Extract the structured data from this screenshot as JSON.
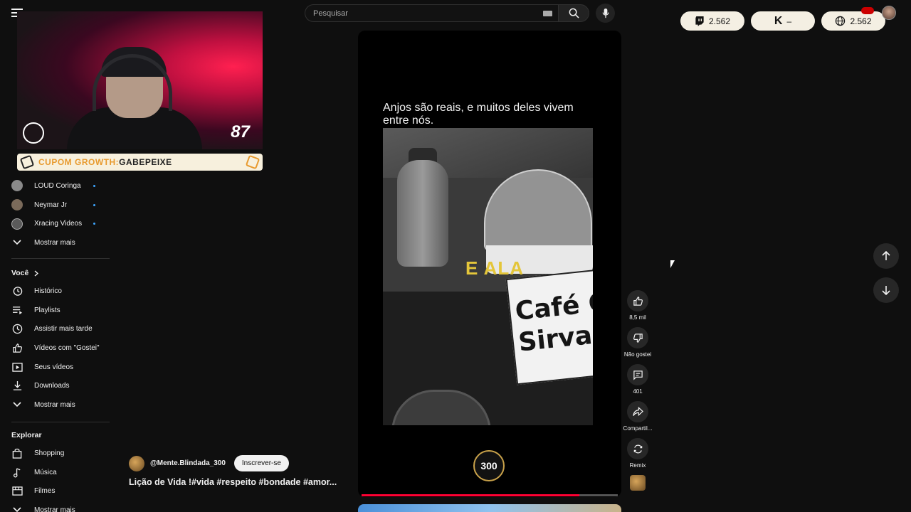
{
  "search": {
    "placeholder": "Pesquisar"
  },
  "sidebar": {
    "subscriptions": [
      {
        "label": "LOUD Coringa",
        "avatar_color": "#8a8a8a"
      },
      {
        "label": "Neymar Jr",
        "avatar_color": "#7a6a5a"
      },
      {
        "label": "Xracing Videos",
        "avatar_color": "#5a5a5a"
      }
    ],
    "show_more_1": "Mostrar mais",
    "you_section": "Você",
    "you_items": [
      {
        "label": "Histórico",
        "icon": "history-icon"
      },
      {
        "label": "Playlists",
        "icon": "playlists-icon"
      },
      {
        "label": "Assistir mais tarde",
        "icon": "watch-later-icon"
      },
      {
        "label": "Vídeos com \"Gostei\"",
        "icon": "like-icon"
      },
      {
        "label": "Seus vídeos",
        "icon": "your-videos-icon"
      },
      {
        "label": "Downloads",
        "icon": "download-icon"
      }
    ],
    "show_more_2": "Mostrar mais",
    "explore_section": "Explorar",
    "explore_items": [
      {
        "label": "Shopping",
        "icon": "shopping-icon"
      },
      {
        "label": "Música",
        "icon": "music-icon"
      },
      {
        "label": "Filmes",
        "icon": "movies-icon"
      }
    ],
    "show_more_3": "Mostrar mais"
  },
  "overlay": {
    "score": "87",
    "coupon_prefix": "CUPOM GROWTH: ",
    "coupon_code": "GABEPEIXE"
  },
  "stats": {
    "twitch": "2.562",
    "kick": "–",
    "total": "2.562"
  },
  "short": {
    "caption": "Anjos são reais, e muitos deles vivem entre nós.",
    "overlay_word": "E ALA",
    "sign_text": "Café G\nSirva",
    "badge": "300",
    "progress": 0.85,
    "channel": "@Mente.Blindada_300",
    "subscribe_label": "Inscrever-se",
    "title": "Lição de Vida !#vida #respeito #bondade #amor..."
  },
  "actions": {
    "likes": "8,5 mil",
    "dislike": "Não gostei",
    "comments": "401",
    "share": "Compartil...",
    "remix": "Remix"
  },
  "colors": {
    "accent_red": "#ff0033",
    "background": "#0f0f0f",
    "pill_bg": "#f4efe3"
  }
}
